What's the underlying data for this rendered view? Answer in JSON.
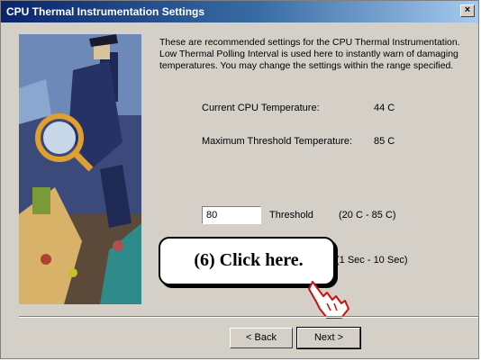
{
  "window": {
    "title": "CPU Thermal Instrumentation Settings",
    "close_label": "×"
  },
  "description": "These are recommended settings for the CPU Thermal Instrumentation. Low Thermal Polling Interval is used here to instantly warn of damaging temperatures. You may change the settings within the range specified.",
  "current_temp": {
    "label": "Current CPU Temperature:",
    "value": "44 C"
  },
  "max_temp": {
    "label": "Maximum Threshold Temperature:",
    "value": "85 C"
  },
  "threshold": {
    "input_value": "80",
    "label": "Threshold",
    "range": "(20 C - 85 C)"
  },
  "polling": {
    "range": "(1 Sec - 10 Sec)"
  },
  "callout": {
    "text": "(6)  Click here."
  },
  "buttons": {
    "back": "< Back",
    "next": "Next >"
  },
  "icons": {
    "pointer": "pointing-hand-icon",
    "close": "close-icon"
  }
}
